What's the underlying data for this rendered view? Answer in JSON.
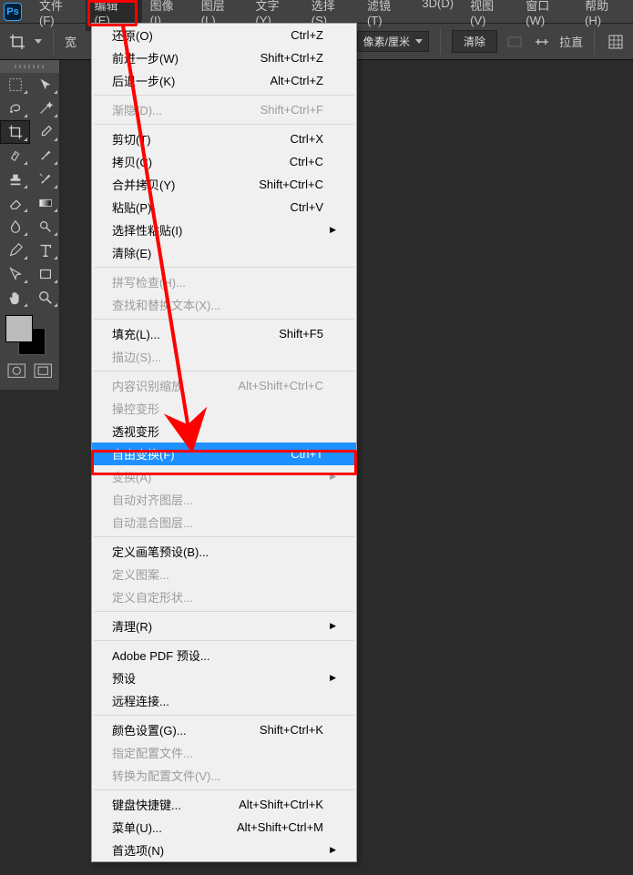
{
  "app": {
    "logo_text": "Ps"
  },
  "menubar": [
    {
      "label": "文件(F)"
    },
    {
      "label": "编辑(E)",
      "active": true
    },
    {
      "label": "图像(I)"
    },
    {
      "label": "图层(L)"
    },
    {
      "label": "文字(Y)"
    },
    {
      "label": "选择(S)"
    },
    {
      "label": "滤镜(T)"
    },
    {
      "label": "3D(D)"
    },
    {
      "label": "视图(V)"
    },
    {
      "label": "窗口(W)"
    },
    {
      "label": "帮助(H)"
    }
  ],
  "optionsbar": {
    "width_label": "宽",
    "units_dropdown": "像素/厘米",
    "clear_btn": "清除",
    "straighten_label": "拉直"
  },
  "edit_menu": [
    {
      "type": "item",
      "label": "还原(O)",
      "shortcut": "Ctrl+Z"
    },
    {
      "type": "item",
      "label": "前进一步(W)",
      "shortcut": "Shift+Ctrl+Z"
    },
    {
      "type": "item",
      "label": "后退一步(K)",
      "shortcut": "Alt+Ctrl+Z"
    },
    {
      "type": "sep"
    },
    {
      "type": "item",
      "label": "渐隐(D)...",
      "shortcut": "Shift+Ctrl+F",
      "disabled": true
    },
    {
      "type": "sep"
    },
    {
      "type": "item",
      "label": "剪切(T)",
      "shortcut": "Ctrl+X"
    },
    {
      "type": "item",
      "label": "拷贝(C)",
      "shortcut": "Ctrl+C"
    },
    {
      "type": "item",
      "label": "合并拷贝(Y)",
      "shortcut": "Shift+Ctrl+C"
    },
    {
      "type": "item",
      "label": "粘贴(P)",
      "shortcut": "Ctrl+V"
    },
    {
      "type": "item",
      "label": "选择性粘贴(I)",
      "submenu": true
    },
    {
      "type": "item",
      "label": "清除(E)"
    },
    {
      "type": "sep"
    },
    {
      "type": "item",
      "label": "拼写检查(H)...",
      "disabled": true
    },
    {
      "type": "item",
      "label": "查找和替换文本(X)...",
      "disabled": true
    },
    {
      "type": "sep"
    },
    {
      "type": "item",
      "label": "填充(L)...",
      "shortcut": "Shift+F5"
    },
    {
      "type": "item",
      "label": "描边(S)...",
      "disabled": true
    },
    {
      "type": "sep"
    },
    {
      "type": "item",
      "label": "内容识别缩放",
      "shortcut": "Alt+Shift+Ctrl+C",
      "disabled": true
    },
    {
      "type": "item",
      "label": "操控变形",
      "disabled": true
    },
    {
      "type": "item",
      "label": "透视变形"
    },
    {
      "type": "item",
      "label": "自由变换(F)",
      "shortcut": "Ctrl+T",
      "selected": true
    },
    {
      "type": "item",
      "label": "变换(A)",
      "submenu": true,
      "disabled": true
    },
    {
      "type": "item",
      "label": "自动对齐图层...",
      "disabled": true
    },
    {
      "type": "item",
      "label": "自动混合图层...",
      "disabled": true
    },
    {
      "type": "sep"
    },
    {
      "type": "item",
      "label": "定义画笔预设(B)..."
    },
    {
      "type": "item",
      "label": "定义图案...",
      "disabled": true
    },
    {
      "type": "item",
      "label": "定义自定形状...",
      "disabled": true
    },
    {
      "type": "sep"
    },
    {
      "type": "item",
      "label": "清理(R)",
      "submenu": true
    },
    {
      "type": "sep"
    },
    {
      "type": "item",
      "label": "Adobe PDF 预设..."
    },
    {
      "type": "item",
      "label": "预设",
      "submenu": true
    },
    {
      "type": "item",
      "label": "远程连接..."
    },
    {
      "type": "sep"
    },
    {
      "type": "item",
      "label": "颜色设置(G)...",
      "shortcut": "Shift+Ctrl+K"
    },
    {
      "type": "item",
      "label": "指定配置文件...",
      "disabled": true
    },
    {
      "type": "item",
      "label": "转换为配置文件(V)...",
      "disabled": true
    },
    {
      "type": "sep"
    },
    {
      "type": "item",
      "label": "键盘快捷键...",
      "shortcut": "Alt+Shift+Ctrl+K"
    },
    {
      "type": "item",
      "label": "菜单(U)...",
      "shortcut": "Alt+Shift+Ctrl+M"
    },
    {
      "type": "item",
      "label": "首选项(N)",
      "submenu": true
    }
  ],
  "tools": [
    "move",
    "marquee",
    "lasso",
    "wand",
    "crop",
    "eyedropper",
    "healing",
    "brush",
    "stamp",
    "history-brush",
    "eraser",
    "gradient",
    "blur",
    "dodge",
    "pen",
    "type",
    "path-select",
    "rectangle",
    "hand",
    "zoom"
  ]
}
